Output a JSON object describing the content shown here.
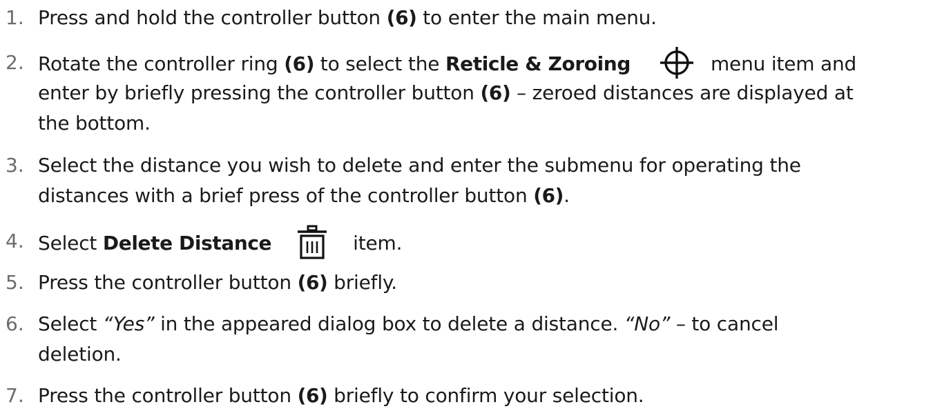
{
  "steps": [
    {
      "number": "1.",
      "lines": [
        [
          "Press and hold the controller button ",
          "(6)",
          " to enter the main menu."
        ]
      ]
    },
    {
      "number": "2.",
      "lines": [
        [
          "Rotate the controller ring ",
          "(6)",
          " to select the ",
          "Reticle & Zoroing",
          "menu item and"
        ],
        [
          "enter by briefly pressing the controller button ",
          "(6)",
          " – zeroed distances are displayed at"
        ],
        [
          "the bottom."
        ]
      ]
    },
    {
      "number": "3.",
      "lines": [
        [
          "Select the distance you wish to delete and enter the submenu for operating the"
        ],
        [
          "distances with a brief press of the controller button ",
          "(6)",
          "."
        ]
      ]
    },
    {
      "number": "4.",
      "lines": [
        [
          "Select ",
          "Delete Distance",
          "item."
        ]
      ]
    },
    {
      "number": "5.",
      "lines": [
        [
          "Press the controller button ",
          "(6)",
          " briefly."
        ]
      ]
    },
    {
      "number": "6.",
      "lines": [
        [
          "Select ",
          "“Yes”",
          " in the appeared dialog box to delete a distance. ",
          "“No”",
          " – to cancel"
        ],
        [
          "deletion."
        ]
      ]
    },
    {
      "number": "7.",
      "lines": [
        [
          "Press the controller button ",
          "(6)",
          " briefly to confirm your selection."
        ]
      ]
    }
  ],
  "icons": {
    "reticle": "crosshair-icon",
    "delete": "trash-icon"
  }
}
